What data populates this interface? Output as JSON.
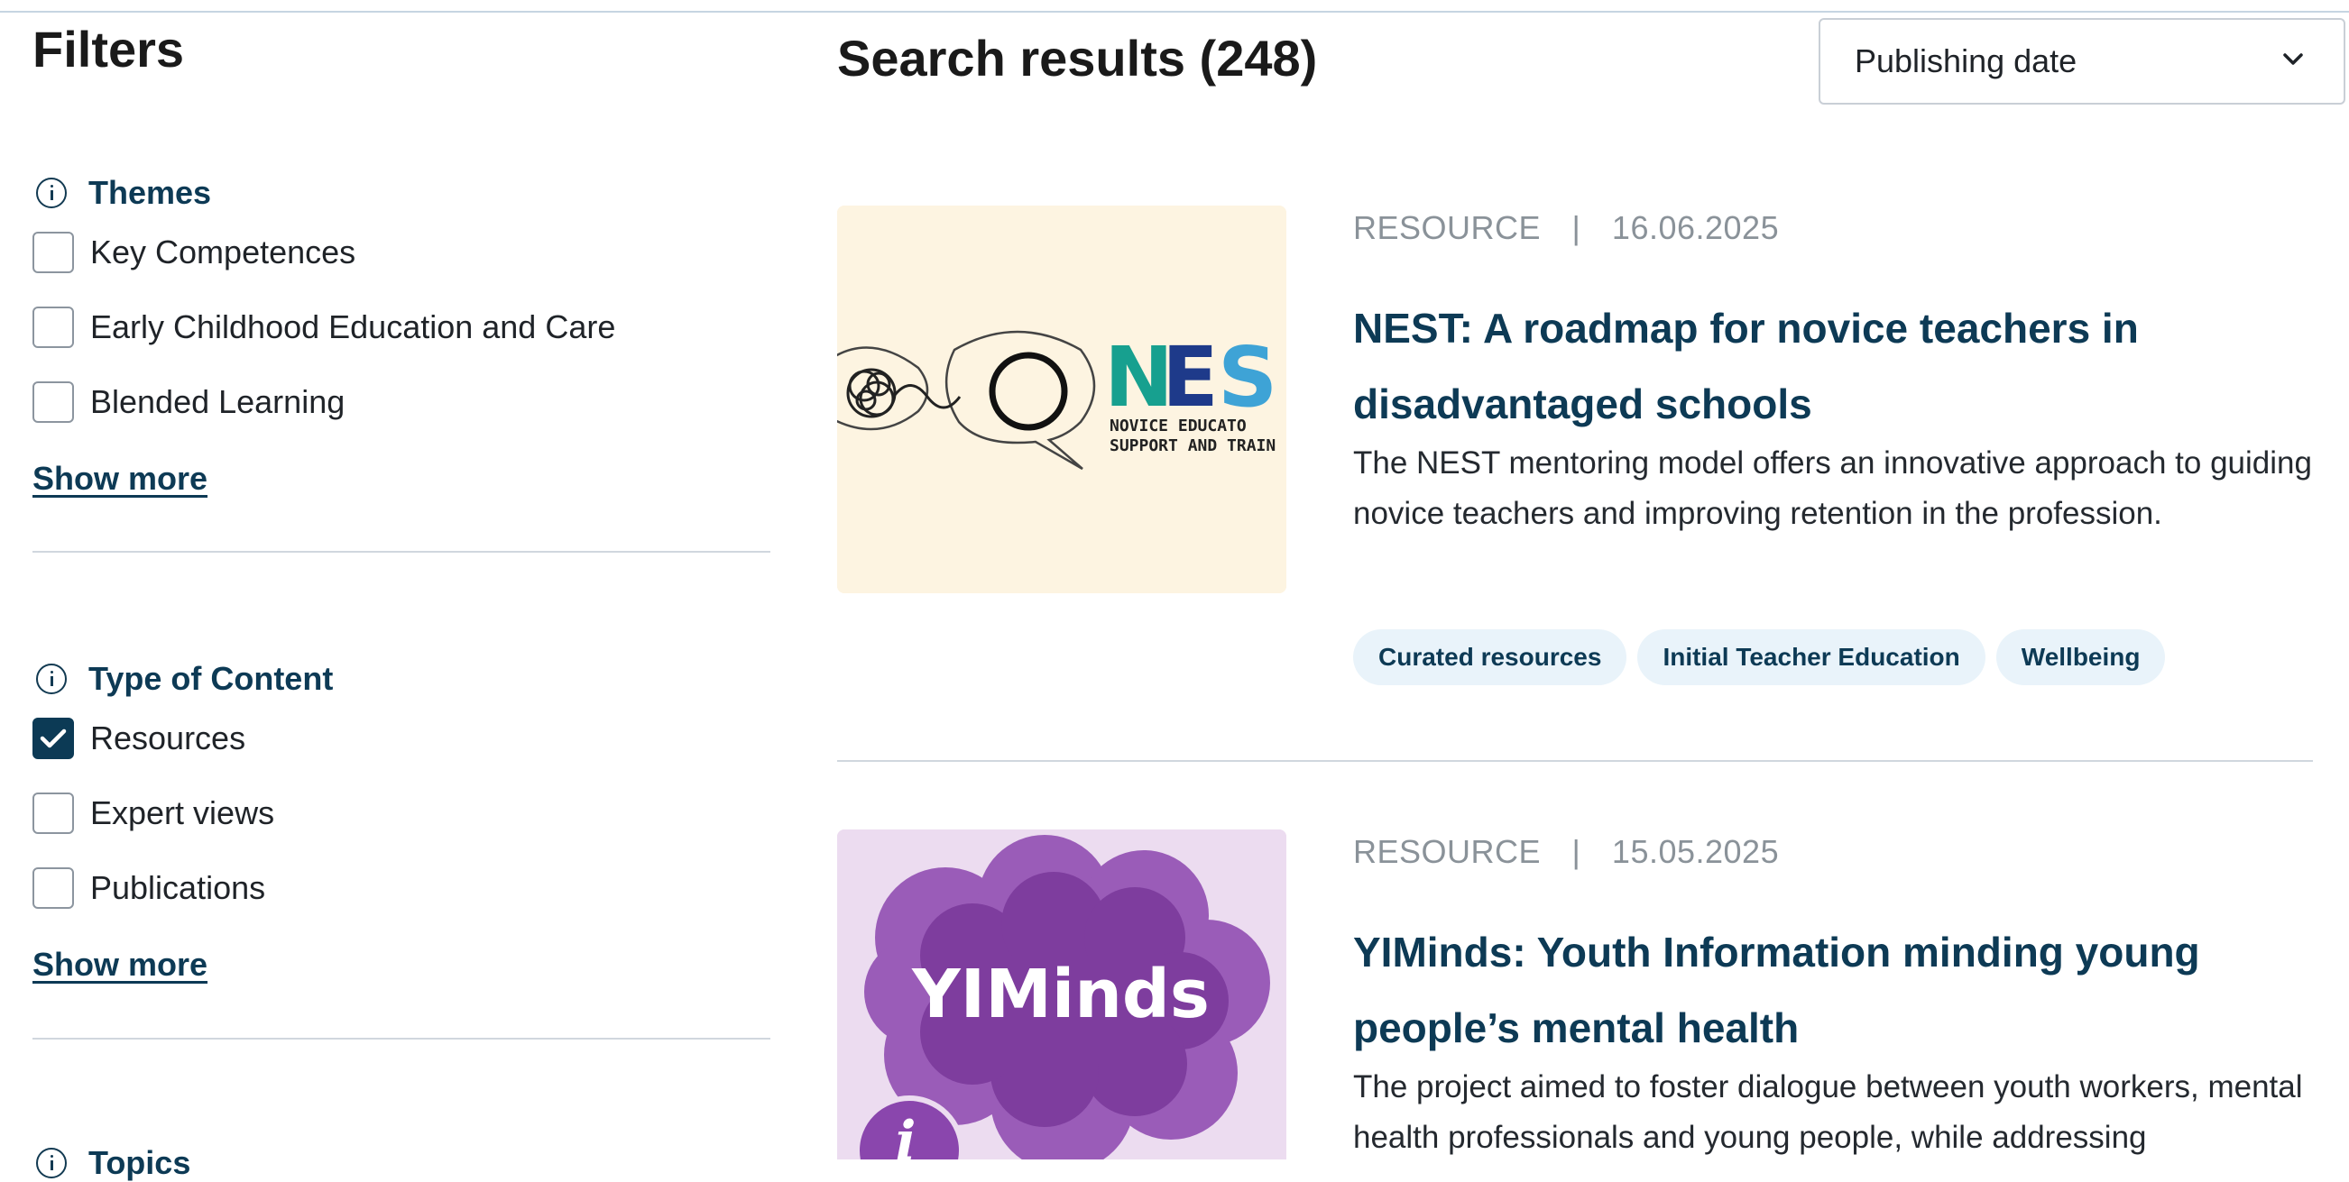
{
  "filters": {
    "title": "Filters",
    "groups": [
      {
        "title": "Themes",
        "options": [
          {
            "label": "Key Competences",
            "checked": false
          },
          {
            "label": "Early Childhood Education and Care",
            "checked": false
          },
          {
            "label": "Blended Learning",
            "checked": false
          }
        ],
        "show_more": "Show more"
      },
      {
        "title": "Type of Content",
        "options": [
          {
            "label": "Resources",
            "checked": true
          },
          {
            "label": "Expert views",
            "checked": false
          },
          {
            "label": "Publications",
            "checked": false
          }
        ],
        "show_more": "Show more"
      },
      {
        "title": "Topics"
      }
    ]
  },
  "results": {
    "title": "Search results (248)",
    "sort_value": "Publishing date",
    "items": [
      {
        "type": "RESOURCE",
        "separator": "|",
        "date": "16.06.2025",
        "title_line1": "NEST: A roadmap for novice teachers in",
        "title_line2": "disadvantaged schools",
        "description": "The NEST mentoring model offers an innovative approach to guiding novice teachers and improving retention in the profession.",
        "tags": [
          "Curated resources",
          "Initial Teacher Education",
          "Wellbeing"
        ],
        "thumbnail": {
          "logo_text": "NES",
          "caption_line1": "NOVICE EDUCATO",
          "caption_line2": "SUPPORT AND TRAIN",
          "background": "#fdf4e1"
        }
      },
      {
        "type": "RESOURCE",
        "separator": "|",
        "date": "15.05.2025",
        "title_line1": "YIMinds: Youth Information minding young",
        "title_line2": "people’s mental health",
        "description": "The project aimed to foster dialogue between youth workers, mental health professionals and young people, while addressing",
        "thumbnail": {
          "logo_text": "YIMinds",
          "glyph": "i",
          "background": "#ecdcf0"
        }
      }
    ]
  },
  "colors": {
    "primary": "#0d3a55",
    "tag_bg": "#e9f3fa",
    "meta": "#8a9299"
  }
}
